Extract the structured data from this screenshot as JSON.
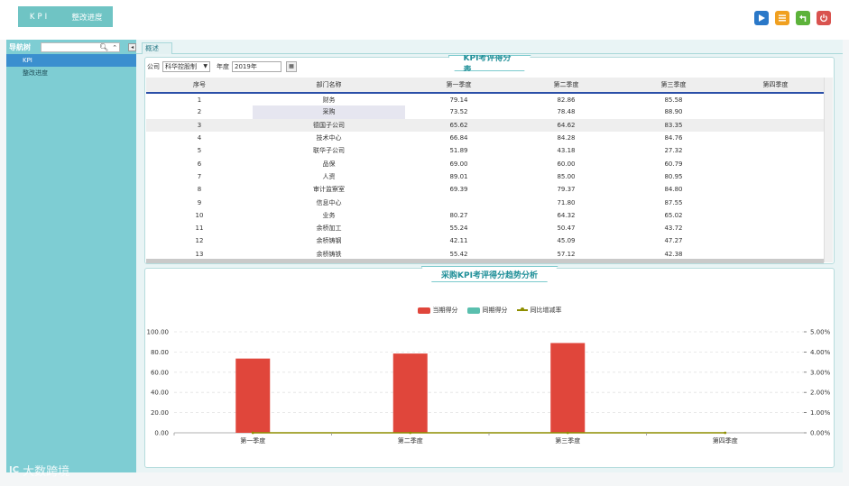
{
  "topnav": {
    "kpi_label": "KPI",
    "rect_label": "整改进度"
  },
  "toolbar": {
    "icons": [
      "play-icon",
      "menu-icon",
      "back-icon",
      "power-icon"
    ]
  },
  "sidebar": {
    "title": "导航树",
    "search": {
      "value": "",
      "placeholder": ""
    },
    "items": [
      {
        "label": "KPI",
        "active": true
      },
      {
        "label": "整改进度",
        "active": false
      }
    ]
  },
  "tabs": [
    {
      "label": "概述"
    }
  ],
  "filters": {
    "company_label": "公司",
    "company_value": "科华控股制",
    "year_label": "年度",
    "year_value": "2019年"
  },
  "table": {
    "title": "KPI考评得分表",
    "columns": [
      "序号",
      "部门名称",
      "第一季度",
      "第二季度",
      "第三季度",
      "第四季度"
    ],
    "rows": [
      [
        "1",
        "财务",
        "79.14",
        "82.86",
        "85.58",
        ""
      ],
      [
        "2",
        "采购",
        "73.52",
        "78.48",
        "88.90",
        ""
      ],
      [
        "3",
        "德国子公司",
        "65.62",
        "64.62",
        "83.35",
        ""
      ],
      [
        "4",
        "技术中心",
        "66.84",
        "84.28",
        "84.76",
        ""
      ],
      [
        "5",
        "联华子公司",
        "51.89",
        "43.18",
        "27.32",
        ""
      ],
      [
        "6",
        "品保",
        "69.00",
        "60.00",
        "60.79",
        ""
      ],
      [
        "7",
        "人资",
        "89.01",
        "85.00",
        "80.95",
        ""
      ],
      [
        "8",
        "审计监察室",
        "69.39",
        "79.37",
        "84.80",
        ""
      ],
      [
        "9",
        "信息中心",
        "",
        "71.80",
        "87.55",
        ""
      ],
      [
        "10",
        "业务",
        "80.27",
        "64.32",
        "65.02",
        ""
      ],
      [
        "11",
        "余桥加工",
        "55.24",
        "50.47",
        "43.72",
        ""
      ],
      [
        "12",
        "余桥铸钢",
        "42.11",
        "45.09",
        "47.27",
        ""
      ],
      [
        "13",
        "余桥铸铁",
        "55.42",
        "57.12",
        "42.38",
        ""
      ]
    ]
  },
  "chart_title": "采购KPI考评得分趋势分析",
  "chart_data": {
    "type": "bar",
    "categories": [
      "第一季度",
      "第二季度",
      "第三季度",
      "第四季度"
    ],
    "series": [
      {
        "name": "当期得分",
        "values": [
          73.52,
          78.48,
          88.9,
          null
        ],
        "color": "#e0463b",
        "axis": "left"
      },
      {
        "name": "同期得分",
        "values": [
          null,
          null,
          null,
          null
        ],
        "color": "#5abfae",
        "axis": "left"
      },
      {
        "name": "同比增减率",
        "type": "line",
        "values": [
          0,
          0,
          0,
          0
        ],
        "color": "#8e8e00",
        "axis": "right"
      }
    ],
    "y_left": {
      "ticks": [
        "0.00",
        "20.00",
        "40.00",
        "60.00",
        "80.00",
        "100.00"
      ],
      "ylim": [
        0,
        100
      ]
    },
    "y_right": {
      "ticks": [
        "0.00%",
        "1.00%",
        "2.00%",
        "3.00%",
        "4.00%",
        "5.00%"
      ],
      "ylim": [
        0,
        5
      ]
    },
    "grid": true,
    "legend": "top-center"
  },
  "watermark": {
    "logo": "IC",
    "text": "大数跨境"
  }
}
